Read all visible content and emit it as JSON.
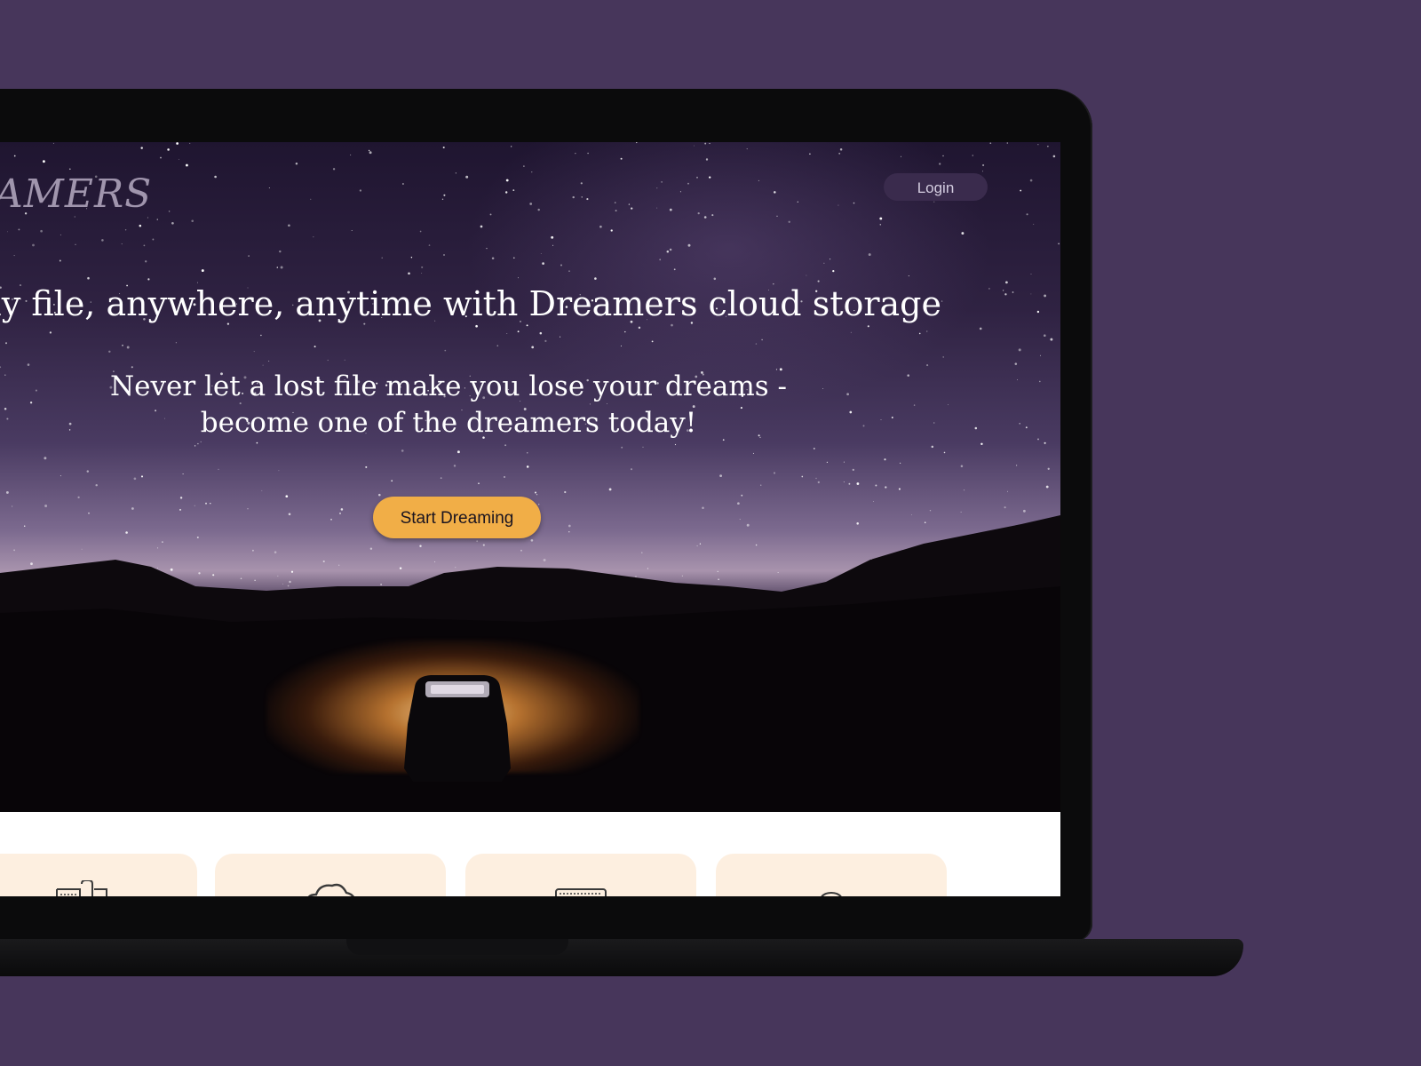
{
  "site": {
    "logo_text": "AMERS",
    "login_label": "Login"
  },
  "hero": {
    "headline": "ad any file, anywhere, anytime with Dreamers cloud storage",
    "subline_1": "Never let a lost file make you lose your dreams -",
    "subline_2": "become one of the dreamers today!",
    "cta_label": "Start Dreaming"
  },
  "features": {
    "cards": [
      {
        "icon": "folder-files-icon"
      },
      {
        "icon": "cloud-icon"
      },
      {
        "icon": "laptop-icon"
      },
      {
        "icon": "user-icon"
      }
    ]
  },
  "colors": {
    "page_background": "#47365b",
    "cta": "#f1ae47",
    "login": "#3a2b4d",
    "card": "#fdefe0"
  }
}
